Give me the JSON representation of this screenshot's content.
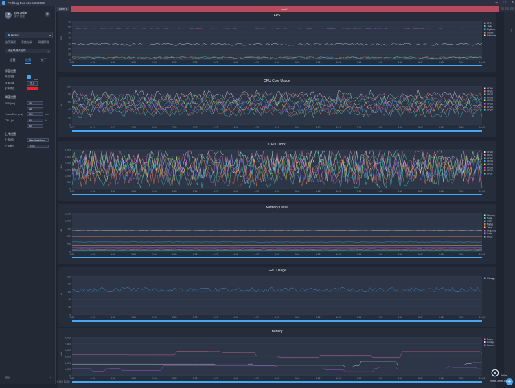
{
  "window": {
    "title": "PerfDog Evo v10.6.240520",
    "min": "–",
    "max": "□",
    "close": "×"
  },
  "user": {
    "name": "net 3elife",
    "plan": "客户类型"
  },
  "device": {
    "name": "MEN1",
    "chevron": "▾"
  },
  "mode_tabs": [
    "应用测试",
    "手势分析",
    "网络探测"
  ],
  "app_select": {
    "placeholder": "请选取测试应用",
    "chevron": "▾"
  },
  "sub_tabs": [
    {
      "label": "设置",
      "active": false
    },
    {
      "label": "设置",
      "active": true
    },
    {
      "label": "关于",
      "active": false
    }
  ],
  "section_float": {
    "title": "浮窗设置",
    "r1": "开启浮窗",
    "r2": "浮窗位置",
    "r2_val": "右上",
    "r3": "字体颜色"
  },
  "section_upload": {
    "title": "阈值设置",
    "fps_label": "FPS (ms)",
    "fps_val1": "15",
    "fps_val2": "25",
    "frame_label": "FrameTime (ms)",
    "frame_val": "100",
    "frame_unit": "ms",
    "cpu_label": "CPU (%)",
    "cpu_val1": "60",
    "cpu_val2": "80",
    "cpu_unit": "%"
  },
  "section_server": {
    "title": "上传设置",
    "url_label": "上传地址",
    "url_val": "https://perfdog.q",
    "fmt_label": "上传格式",
    "fmt_val": "JSON"
  },
  "bottom": {
    "collapse": "退出",
    "arrow": "«"
  },
  "case": {
    "tab": "Label 1",
    "name": "label1"
  },
  "time_ticks": [
    "0:00",
    "0:31",
    "1:02",
    "1:33",
    "2:04",
    "2:35",
    "3:06",
    "3:37",
    "4:08",
    "4:39",
    "5:10",
    "5:41",
    "6:12",
    "6:43",
    "7:14",
    "7:45",
    "8:16",
    "8:47",
    "9:18",
    "9:49",
    "10:20"
  ],
  "panels": [
    {
      "title": "FPS",
      "ylabel": "FPS",
      "yticks": [
        "70",
        "60",
        "50",
        "40",
        "30",
        "20",
        "10",
        "0"
      ],
      "legend": [
        "FPS",
        "Jank",
        "BigJank",
        "Stutter",
        "InterFrame"
      ],
      "colors": [
        "#d94fd9",
        "#4ad97f",
        "#3da8ff",
        "#ff7b3d",
        "#e8e8e8"
      ]
    },
    {
      "title": "CPU Core Usage",
      "ylabel": "%",
      "yticks": [
        "100",
        "80",
        "60",
        "40",
        "20",
        "0"
      ],
      "legend": [
        "CPU0",
        "CPU1",
        "CPU2",
        "CPU3",
        "CPU4",
        "CPU5",
        "CPU6",
        "CPU7"
      ],
      "colors": [
        "#e8e8e8",
        "#ff6b9a",
        "#4ad97f",
        "#3da8ff",
        "#ffd24a",
        "#b35cff",
        "#ff7b3d",
        "#3dd9d9"
      ]
    },
    {
      "title": "CPU Clock",
      "ylabel": "MHz",
      "yticks": [
        "3,000",
        "2,500",
        "2,000",
        "1,500",
        "1,000",
        "500",
        "0"
      ],
      "legend": [
        "CPU0",
        "CPU1",
        "CPU2",
        "CPU3",
        "CPU4",
        "CPU5",
        "CPU6",
        "CPU7"
      ],
      "colors": [
        "#e8e8e8",
        "#ff6b9a",
        "#4ad97f",
        "#3da8ff",
        "#ffd24a",
        "#b35cff",
        "#ff7b3d",
        "#3dd9d9"
      ]
    },
    {
      "title": "Memory Detail",
      "ylabel": "MB",
      "yticks": [
        "1,250",
        "1,000",
        "750",
        "500",
        "250",
        "0"
      ],
      "legend": [
        "Memory",
        "Swap",
        "VSS",
        "Native",
        "Java",
        "Graphics",
        "Code",
        "Stack"
      ],
      "colors": [
        "#e8e8e8",
        "#4ad97f",
        "#3da8ff",
        "#ff7b3d",
        "#ffd24a",
        "#b35cff",
        "#ff6b9a",
        "#3dd9d9"
      ]
    },
    {
      "title": "GPU Usage",
      "ylabel": "%",
      "yticks": [
        "100",
        "80",
        "60",
        "40",
        "20",
        "0"
      ],
      "legend": [
        "GUsage"
      ],
      "colors": [
        "#3da8ff"
      ]
    },
    {
      "title": "Battery",
      "ylabel": "mW",
      "yticks": [
        "9,000",
        "7,500",
        "6,000",
        "4,500",
        "3,000",
        "1,500",
        "0"
      ],
      "legend": [
        "Power",
        "Voltage",
        "Current"
      ],
      "colors": [
        "#ff6b9a",
        "#e8e8e8",
        "#b35cff"
      ]
    }
  ],
  "watermark": {
    "glyph": "⊙",
    "line1": "3elife",
    "line2": "www.3elife.net"
  },
  "status": "0:00 / 10:20"
}
